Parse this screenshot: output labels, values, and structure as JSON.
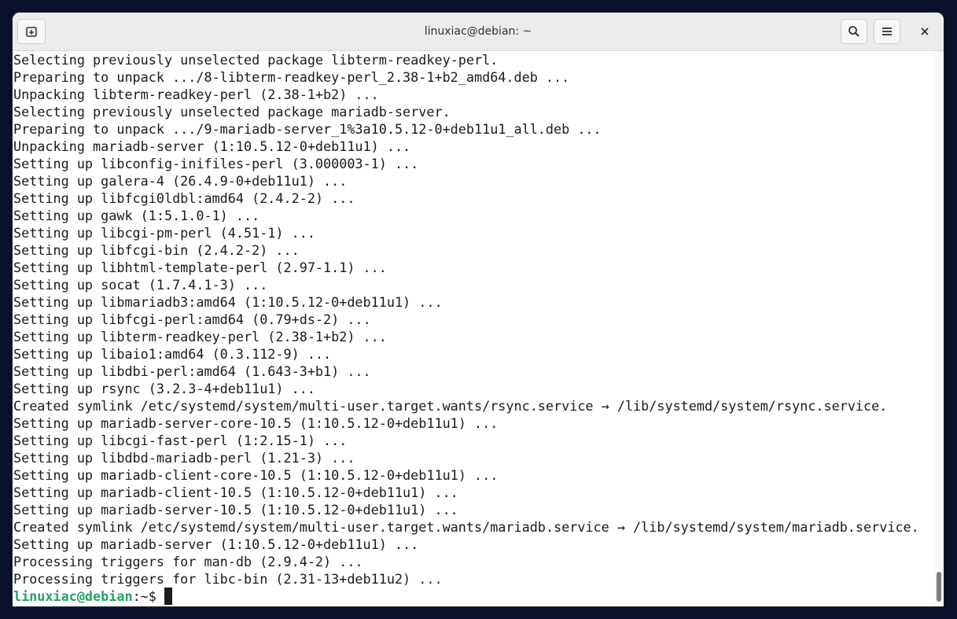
{
  "window": {
    "title": "linuxiac@debian: ~"
  },
  "icons": {
    "new_tab": "new-tab-icon",
    "search": "search-icon",
    "menu": "hamburger-menu-icon",
    "close": "close-icon"
  },
  "colors": {
    "prompt_user": "#26a269",
    "text": "#1a1a1a",
    "titlebar": "#ebebeb"
  },
  "terminal": {
    "lines": [
      "Selecting previously unselected package libterm-readkey-perl.",
      "Preparing to unpack .../8-libterm-readkey-perl_2.38-1+b2_amd64.deb ...",
      "Unpacking libterm-readkey-perl (2.38-1+b2) ...",
      "Selecting previously unselected package mariadb-server.",
      "Preparing to unpack .../9-mariadb-server_1%3a10.5.12-0+deb11u1_all.deb ...",
      "Unpacking mariadb-server (1:10.5.12-0+deb11u1) ...",
      "Setting up libconfig-inifiles-perl (3.000003-1) ...",
      "Setting up galera-4 (26.4.9-0+deb11u1) ...",
      "Setting up libfcgi0ldbl:amd64 (2.4.2-2) ...",
      "Setting up gawk (1:5.1.0-1) ...",
      "Setting up libcgi-pm-perl (4.51-1) ...",
      "Setting up libfcgi-bin (2.4.2-2) ...",
      "Setting up libhtml-template-perl (2.97-1.1) ...",
      "Setting up socat (1.7.4.1-3) ...",
      "Setting up libmariadb3:amd64 (1:10.5.12-0+deb11u1) ...",
      "Setting up libfcgi-perl:amd64 (0.79+ds-2) ...",
      "Setting up libterm-readkey-perl (2.38-1+b2) ...",
      "Setting up libaio1:amd64 (0.3.112-9) ...",
      "Setting up libdbi-perl:amd64 (1.643-3+b1) ...",
      "Setting up rsync (3.2.3-4+deb11u1) ...",
      "Created symlink /etc/systemd/system/multi-user.target.wants/rsync.service → /lib/systemd/system/rsync.service.",
      "Setting up mariadb-server-core-10.5 (1:10.5.12-0+deb11u1) ...",
      "Setting up libcgi-fast-perl (1:2.15-1) ...",
      "Setting up libdbd-mariadb-perl (1.21-3) ...",
      "Setting up mariadb-client-core-10.5 (1:10.5.12-0+deb11u1) ...",
      "Setting up mariadb-client-10.5 (1:10.5.12-0+deb11u1) ...",
      "Setting up mariadb-server-10.5 (1:10.5.12-0+deb11u1) ...",
      "Created symlink /etc/systemd/system/multi-user.target.wants/mariadb.service → /lib/systemd/system/mariadb.service.",
      "Setting up mariadb-server (1:10.5.12-0+deb11u1) ...",
      "Processing triggers for man-db (2.9.4-2) ...",
      "Processing triggers for libc-bin (2.31-13+deb11u2) ..."
    ],
    "prompt": {
      "user_host": "linuxiac@debian",
      "separator": ":",
      "path": "~$ "
    }
  }
}
